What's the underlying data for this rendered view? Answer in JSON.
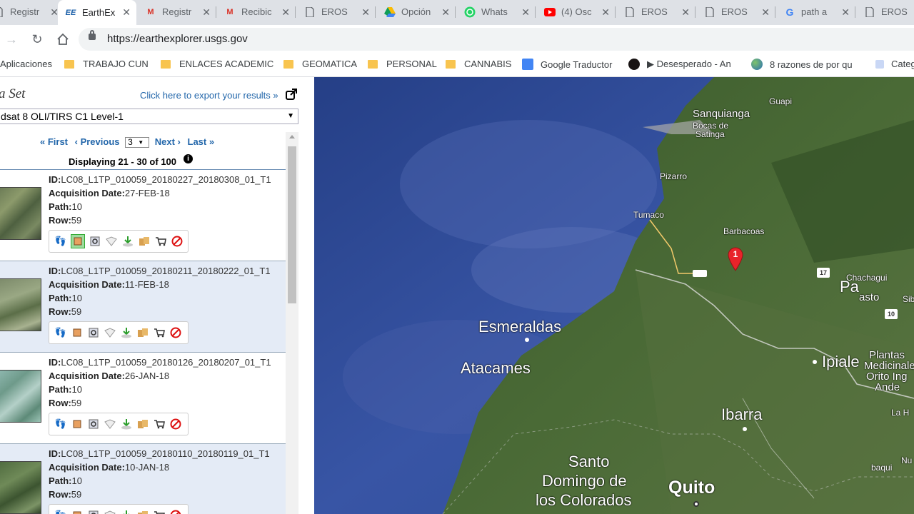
{
  "browser": {
    "tabs": [
      {
        "title": "Registr",
        "icon": "doc",
        "active": false
      },
      {
        "title": "EarthEx",
        "icon": "ee",
        "active": true
      },
      {
        "title": "Registr",
        "icon": "gmail",
        "active": false
      },
      {
        "title": "Recibic",
        "icon": "gmail",
        "active": false
      },
      {
        "title": "EROS",
        "icon": "doc",
        "active": false
      },
      {
        "title": "Opción",
        "icon": "drive",
        "active": false
      },
      {
        "title": "Whats",
        "icon": "whatsapp",
        "active": false
      },
      {
        "title": "(4) Osc",
        "icon": "youtube",
        "active": false
      },
      {
        "title": "EROS",
        "icon": "doc",
        "active": false
      },
      {
        "title": "EROS",
        "icon": "doc",
        "active": false
      },
      {
        "title": "path a",
        "icon": "google",
        "active": false
      },
      {
        "title": "EROS",
        "icon": "doc",
        "active": false
      }
    ],
    "url": "https://earthexplorer.usgs.gov",
    "bookmarks": [
      {
        "label": "Aplicaciones",
        "type": "apps"
      },
      {
        "label": "TRABAJO CUN",
        "type": "folder"
      },
      {
        "label": "ENLACES ACADEMIC",
        "type": "folder"
      },
      {
        "label": "GEOMATICA",
        "type": "folder"
      },
      {
        "label": "PERSONAL",
        "type": "folder"
      },
      {
        "label": "CANNABIS",
        "type": "folder"
      },
      {
        "label": "Google Traductor",
        "type": "translate"
      },
      {
        "label": "▶ Desesperado - An",
        "type": "spotify"
      },
      {
        "label": "8 razones de por qu",
        "type": "globe"
      },
      {
        "label": "Categ",
        "type": "page"
      }
    ]
  },
  "panel": {
    "title": "a Set",
    "export_link": "Click here to export your results »",
    "dataset": "dsat 8 OLI/TIRS C1 Level-1",
    "pager": {
      "first": "« First",
      "previous": "‹ Previous",
      "page": "3",
      "next": "Next ›",
      "last": "Last »"
    },
    "displaying": "Displaying 21 - 30 of 100",
    "labels": {
      "id": "ID:",
      "acq": "Acquisition Date:",
      "path": "Path:",
      "row": "Row:"
    },
    "results": [
      {
        "id": "LC08_L1TP_010059_20180227_20180308_01_T1",
        "date": "27-FEB-18",
        "path": "10",
        "row": "59"
      },
      {
        "id": "LC08_L1TP_010059_20180211_20180222_01_T1",
        "date": "11-FEB-18",
        "path": "10",
        "row": "59"
      },
      {
        "id": "LC08_L1TP_010059_20180126_20180207_01_T1",
        "date": "26-JAN-18",
        "path": "10",
        "row": "59"
      },
      {
        "id": "LC08_L1TP_010059_20180110_20180119_01_T1",
        "date": "10-JAN-18",
        "path": "10",
        "row": "59"
      }
    ],
    "result_icons": [
      "footprint-icon",
      "browse-overlay-icon",
      "compare-icon",
      "metadata-icon",
      "download-icon",
      "bulk-download-icon",
      "order-cart-icon",
      "exclude-icon"
    ]
  },
  "map": {
    "marker": "1",
    "labels": [
      {
        "text": "Guapi",
        "size": "s"
      },
      {
        "text": "Sanquianga",
        "size": "m"
      },
      {
        "text": "Bocas de",
        "size": "s"
      },
      {
        "text": "Satinga",
        "size": "s"
      },
      {
        "text": "Pizarro",
        "size": "s"
      },
      {
        "text": "Tumaco",
        "size": "s"
      },
      {
        "text": "Barbacoas",
        "size": "s"
      },
      {
        "text": "Chachagui",
        "size": "s"
      },
      {
        "text": "Pa",
        "size": "l"
      },
      {
        "text": "asto",
        "size": "m"
      },
      {
        "text": "Sib",
        "size": "s"
      },
      {
        "text": "Esmeraldas",
        "size": "l"
      },
      {
        "text": "Atacames",
        "size": "l"
      },
      {
        "text": "Ipiale",
        "size": "l"
      },
      {
        "text": "Plantas",
        "size": "m"
      },
      {
        "text": "Medicinale",
        "size": "m"
      },
      {
        "text": "Orito Ing",
        "size": "m"
      },
      {
        "text": "Ande",
        "size": "m"
      },
      {
        "text": "Ibarra",
        "size": "l"
      },
      {
        "text": "La H",
        "size": "s"
      },
      {
        "text": "Santo",
        "size": "l"
      },
      {
        "text": "Domingo de",
        "size": "l"
      },
      {
        "text": "los Colorados",
        "size": "l"
      },
      {
        "text": "Quito",
        "size": "xl"
      },
      {
        "text": "Nu",
        "size": "s"
      },
      {
        "text": "baqui",
        "size": "s"
      }
    ],
    "shields": [
      "17",
      "10"
    ]
  }
}
